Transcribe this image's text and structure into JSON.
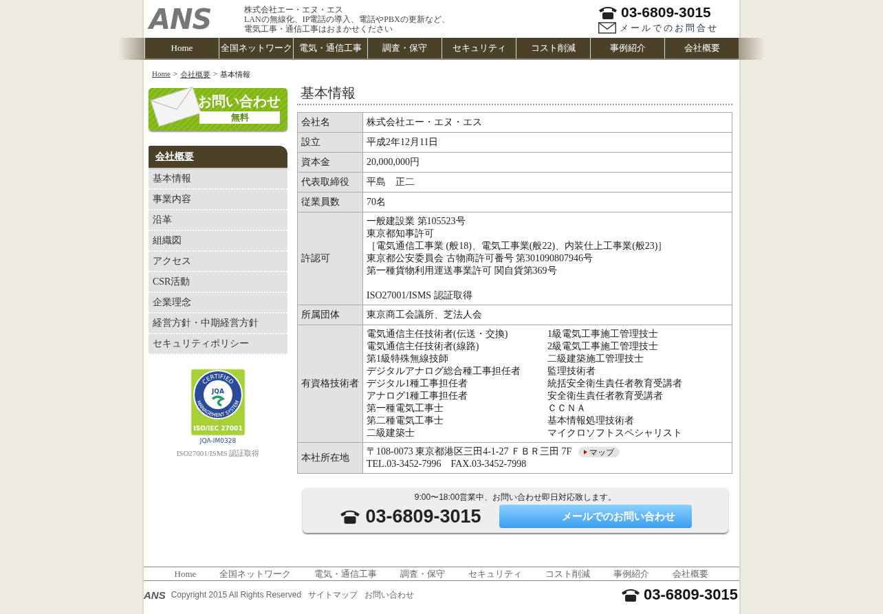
{
  "header": {
    "logo": "ANS",
    "company": "株式会社エー・エヌ・エス",
    "tagline_1": "LANの無線化、IP電話の導入、電話やPBXの更新など、",
    "tagline_2": "電気工事・通信工事はおまかせください",
    "phone": "03-6809-3015",
    "mail_link": "メールでのお問合せ"
  },
  "nav": [
    "Home",
    "全国ネットワーク",
    "電気・通信工事",
    "調査・保守",
    "セキュリティ",
    "コスト削減",
    "事例紹介",
    "会社概要"
  ],
  "breadcrumb": {
    "links": [
      "Home",
      "会社概要"
    ],
    "separator": ">",
    "current": "基本情報"
  },
  "contact_banner": {
    "title": "お問い合わせ",
    "badge": "無料"
  },
  "sidebar": {
    "heading": "会社概要",
    "items": [
      "基本情報",
      "事業内容",
      "沿革",
      "組織図",
      "アクセス",
      "CSR活動",
      "企業理念",
      "経営方針・中期経営方針",
      "セキュリティポリシー"
    ]
  },
  "cert": {
    "top": "CERTIFIED",
    "bottom": "MANAGEMENT SYSTEM",
    "mark": "JQA",
    "standard": "ISO/IEC 27001",
    "number": "JQA-IM0328",
    "caption": "ISO27001/ISMS 認証取得"
  },
  "page_title": "基本情報",
  "table": [
    {
      "kind": "text",
      "label": "会社名",
      "value": "株式会社エー・エヌ・エス"
    },
    {
      "kind": "text",
      "label": "設立",
      "value": "平成2年12月11日"
    },
    {
      "kind": "text",
      "label": "資本金",
      "value": "20,000,000円"
    },
    {
      "kind": "text",
      "label": "代表取締役",
      "value": "平島　正二"
    },
    {
      "kind": "text",
      "label": "従業員数",
      "value": "70名"
    },
    {
      "kind": "blocks",
      "label": "許認可",
      "blocks": [
        [
          "一般建設業 第105523号",
          "東京都知事許可",
          "［電気通信工事業 (般18)、電気工事業(般22)、内装仕上工事業(般23)］",
          "東京都公安委員会 古物商許可番号 第301090807946号",
          "第一種貨物利用運送事業許可 関自貨第369号"
        ],
        [
          "ISO27001/ISMS 認証取得"
        ]
      ]
    },
    {
      "kind": "text",
      "label": "所属団体",
      "value": "東京商工会議所、芝法人会"
    },
    {
      "kind": "columns",
      "label": "有資格技術者",
      "columns": [
        [
          "電気通信主任技術者(伝送・交換)",
          "電気通信主任技術者(線路)",
          "第1級特殊無線技師",
          "デジタルアナログ総合種工事担任者",
          "デジタル1種工事担任者",
          "アナログ1種工事担任者",
          "第一種電気工事士",
          "第二種電気工事士",
          "二級建築士"
        ],
        [
          "1級電気工事施工管理技士",
          "2級電気工事施工管理技士",
          "二級建築施工管理技士",
          "監理技術者",
          "統括安全衛生責任者教育受講者",
          "安全衛生責任者教育受講者",
          "ＣＣＮＡ",
          "基本情報処理技術者",
          "マイクロソフトスペシャリスト"
        ]
      ]
    },
    {
      "kind": "address",
      "label": "本社所在地",
      "address": "〒108-0073 東京都港区三田4-1-27 ＦＢＲ三田 7F",
      "map": "マップ",
      "contact": "TEL.03-3452-7996　FAX.03-3452-7998"
    }
  ],
  "bottom_banner": {
    "hours": "9:00〜18:00営業中、お問い合わせ即日対応致します。",
    "phone": "03-6809-3015",
    "mail_button": "メールでのお問い合わせ"
  },
  "footer": {
    "nav": [
      "Home",
      "全国ネットワーク",
      "電気・通信工事",
      "調査・保守",
      "セキュリティ",
      "コスト削減",
      "事例紹介",
      "会社概要"
    ],
    "logo": "ANS",
    "copyright": "Copyright 2015  All Rights Reserved",
    "links": [
      "サイトマップ",
      "お問い合わせ"
    ],
    "phone": "03-6809-3015"
  }
}
